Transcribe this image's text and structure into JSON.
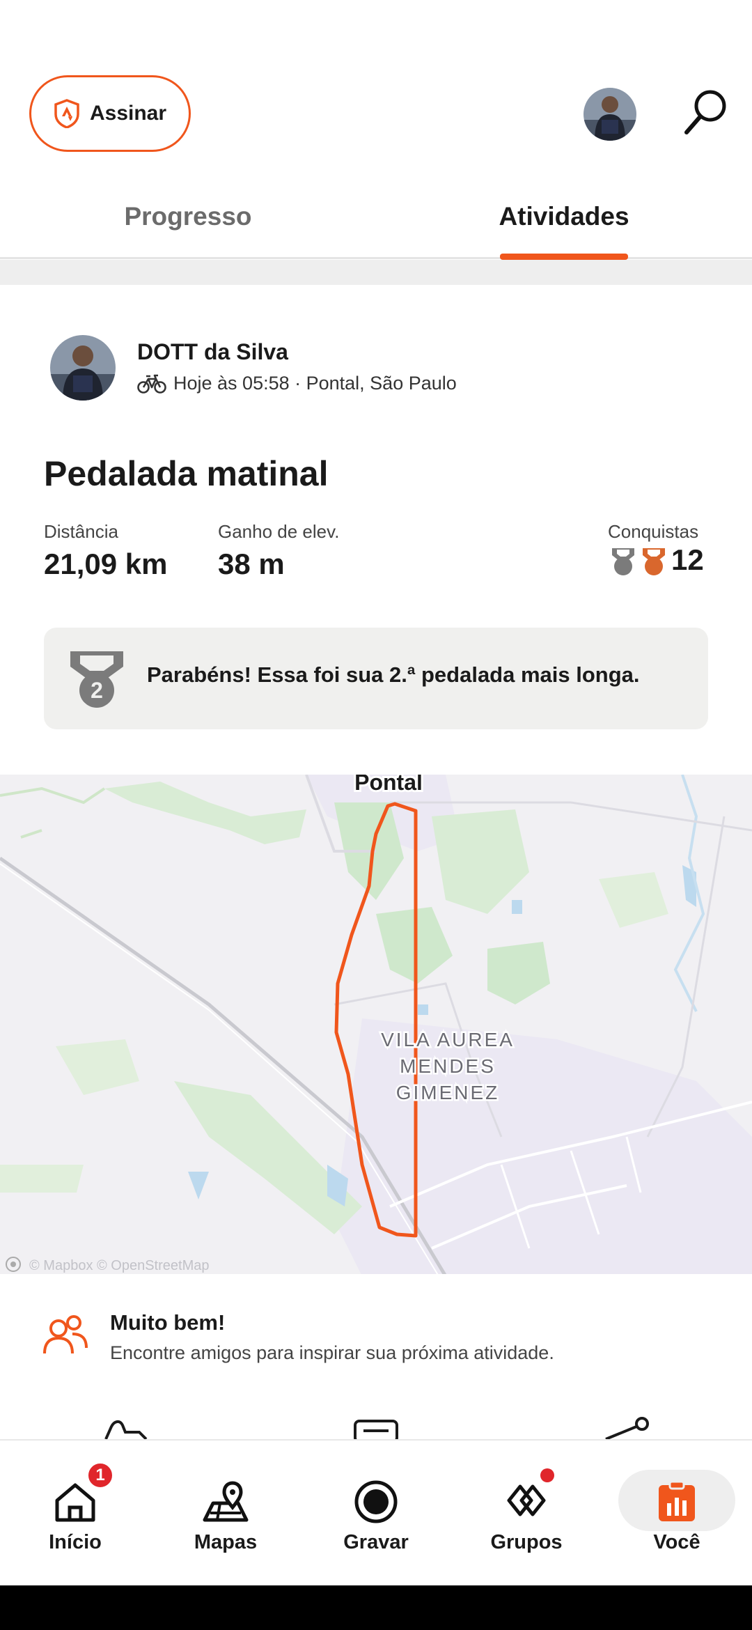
{
  "header": {
    "subscribe_label": "Assinar",
    "brand_color": "#f0561c"
  },
  "tabs": [
    {
      "label": "Progresso",
      "active": false
    },
    {
      "label": "Atividades",
      "active": true
    }
  ],
  "activity": {
    "athlete_name": "DOTT da Silva",
    "meta": "Hoje às 05:58 · Pontal, São Paulo",
    "title": "Pedalada matinal",
    "stats": {
      "distance_label": "Distância",
      "distance_value": "21,09 km",
      "elevation_label": "Ganho de elev.",
      "elevation_value": "38 m",
      "achievements_label": "Conquistas",
      "achievements_value": "12"
    },
    "pr_banner": {
      "medal_number": "2",
      "text": "Parabéns! Essa foi sua 2.ª pedalada mais longa."
    },
    "map": {
      "town_label": "Pontal",
      "district_label": [
        "VILA AUREA",
        "MENDES",
        "GIMENEZ"
      ],
      "attribution": "© Mapbox © OpenStreetMap",
      "route_color": "#f0561c"
    }
  },
  "suggestion": {
    "title": "Muito bem!",
    "subtitle": "Encontre amigos para inspirar sua próxima atividade."
  },
  "bottom_nav": [
    {
      "label": "Início",
      "icon": "home-icon",
      "badge": "1"
    },
    {
      "label": "Mapas",
      "icon": "maps-icon"
    },
    {
      "label": "Gravar",
      "icon": "record-icon"
    },
    {
      "label": "Grupos",
      "icon": "groups-icon",
      "dot": true
    },
    {
      "label": "Você",
      "icon": "you-icon",
      "active": true
    }
  ]
}
